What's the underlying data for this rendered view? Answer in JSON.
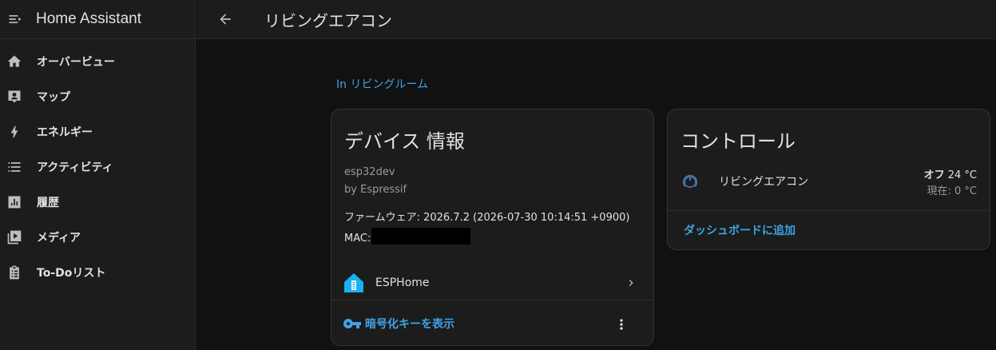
{
  "app": {
    "title": "Home Assistant"
  },
  "sidebar": {
    "items": [
      {
        "label": "オーバービュー",
        "icon": "home-icon"
      },
      {
        "label": "マップ",
        "icon": "map-icon"
      },
      {
        "label": "エネルギー",
        "icon": "lightning-icon"
      },
      {
        "label": "アクティビティ",
        "icon": "list-icon"
      },
      {
        "label": "履歴",
        "icon": "chart-box-icon"
      },
      {
        "label": "メディア",
        "icon": "media-icon"
      },
      {
        "label": "To-Doリスト",
        "icon": "clipboard-list-icon"
      }
    ]
  },
  "header": {
    "title": "リビングエアコン"
  },
  "area": {
    "label": "In リビングルーム"
  },
  "device_card": {
    "title": "デバイス 情報",
    "model": "esp32dev",
    "manufacturer": "by Espressif",
    "firmware": "ファームウェア: 2026.7.2 (2026-07-30 10:14:51 +0900)",
    "mac_label": "MAC:",
    "integration": {
      "name": "ESPHome",
      "icon": "esphome-icon"
    },
    "encryption_button": "暗号化キーを表示"
  },
  "control_card": {
    "title": "コントロール",
    "entity": {
      "name": "リビングエアコン",
      "state": "オフ",
      "target": " 24 °C",
      "current": "現在: 0 °C",
      "icon": "thermostat-icon"
    },
    "add_to_dashboard": "ダッシュボードに追加"
  },
  "colors": {
    "accent": "#3ea3e6",
    "background": "#111111",
    "card": "#1c1c1c",
    "esphome_blue": "#18b2f2",
    "thermostat_icon": "#44739e"
  }
}
